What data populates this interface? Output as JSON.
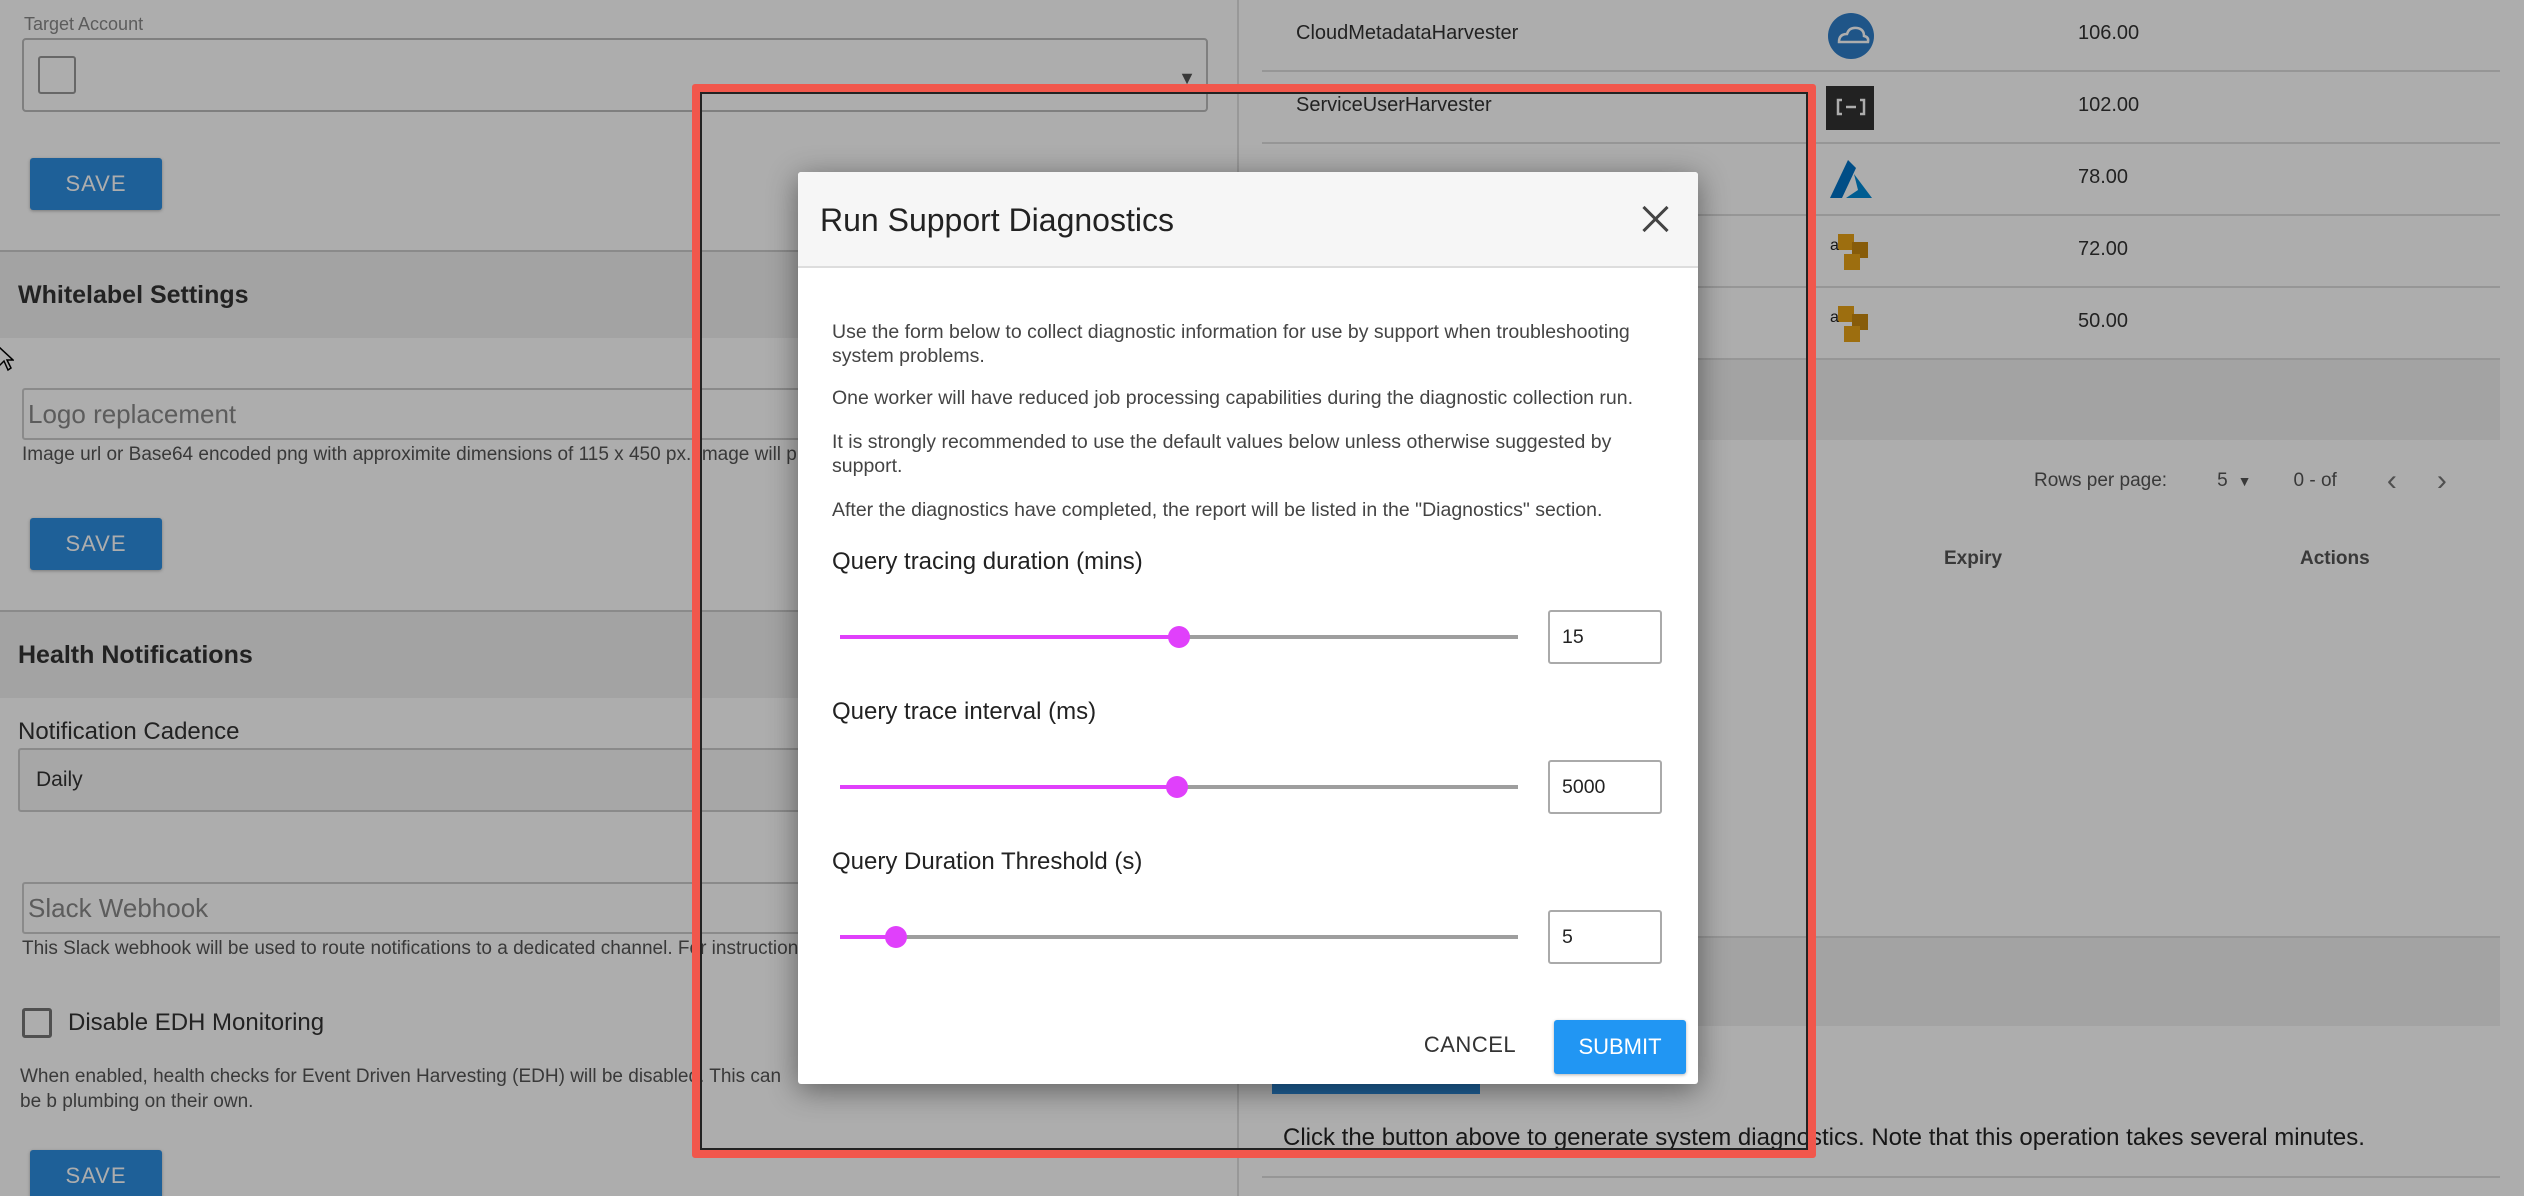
{
  "settings": {
    "target_account_label": "Target Account",
    "save_label": "SAVE",
    "whitelabel": {
      "title": "Whitelabel Settings",
      "logo_placeholder": "Logo replacement",
      "logo_hint": "Image url or Base64 encoded png with approximite dimensions of 115 x 450 px. Image will prev"
    },
    "health": {
      "title": "Health Notifications",
      "cadence_label": "Notification Cadence",
      "cadence_value": "Daily",
      "slack_placeholder": "Slack Webhook",
      "slack_hint": "This Slack webhook will be used to route notifications to a dedicated channel. For instructions o",
      "edh_label": "Disable EDH Monitoring",
      "edh_desc": "When enabled, health checks for Event Driven Harvesting (EDH) will be disabled. This can be b plumbing on their own."
    }
  },
  "harvesters": {
    "rows": [
      {
        "name": "CloudMetadataHarvester",
        "icon": "cloud-icon",
        "value": "106.00"
      },
      {
        "name": "ServiceUserHarvester",
        "icon": "alibaba-cloud-icon",
        "value": "102.00"
      },
      {
        "name": "",
        "icon": "azure-icon",
        "value": "78.00"
      },
      {
        "name": "",
        "icon": "aws-icon",
        "value": "72.00"
      },
      {
        "name": "",
        "icon": "aws-icon",
        "value": "50.00"
      }
    ],
    "pagination": {
      "rows_per_page_label": "Rows per page:",
      "rows_per_page_value": "5",
      "range": "0 - of"
    },
    "columns": {
      "expiry": "Expiry",
      "actions": "Actions"
    }
  },
  "diagnostics_note": "Click the button above to generate system diagnostics. Note that this operation takes several minutes.",
  "modal": {
    "title": "Run Support Diagnostics",
    "paragraphs": [
      "Use the form below to collect diagnostic information for use by support when troubleshooting system problems.",
      "One worker will have reduced job processing capabilities during the diagnostic collection run.",
      "It is strongly recommended to use the default values below unless otherwise suggested by support.",
      "After the diagnostics have completed, the report will be listed in the \"Diagnostics\" section."
    ],
    "sliders": [
      {
        "label": "Query tracing duration (mins)",
        "value": "15",
        "fraction": 0.5
      },
      {
        "label": "Query trace interval (ms)",
        "value": "5000",
        "fraction": 0.497
      },
      {
        "label": "Query Duration Threshold (s)",
        "value": "5",
        "fraction": 0.082
      }
    ],
    "cancel_label": "CANCEL",
    "submit_label": "SUBMIT"
  },
  "colors": {
    "accent": "#2196f3",
    "slider": "#e040fb",
    "annotation": "#f1574c"
  }
}
